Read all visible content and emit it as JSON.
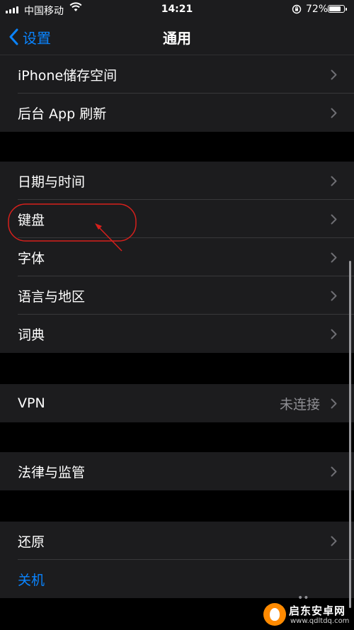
{
  "status_bar": {
    "carrier": "中国移动",
    "time": "14:21",
    "battery_percent": "72%",
    "battery_level": 0.72
  },
  "nav": {
    "back_label": "设置",
    "title": "通用"
  },
  "groups": [
    {
      "rows": [
        {
          "label": "iPhone储存空间"
        },
        {
          "label": "后台 App 刷新"
        }
      ]
    },
    {
      "rows": [
        {
          "label": "日期与时间"
        },
        {
          "label": "键盘"
        },
        {
          "label": "字体"
        },
        {
          "label": "语言与地区"
        },
        {
          "label": "词典"
        }
      ]
    },
    {
      "rows": [
        {
          "label": "VPN",
          "value": "未连接"
        }
      ]
    },
    {
      "rows": [
        {
          "label": "法律与监管"
        }
      ]
    },
    {
      "rows": [
        {
          "label": "还原"
        },
        {
          "label": "关机"
        }
      ]
    }
  ],
  "watermark": {
    "name": "启东安卓网",
    "url": "www.qdltdq.com"
  },
  "colors": {
    "accent": "#0a84ff",
    "annotation": "#d6201c",
    "background": "#000000",
    "cell": "#1c1c1e"
  }
}
